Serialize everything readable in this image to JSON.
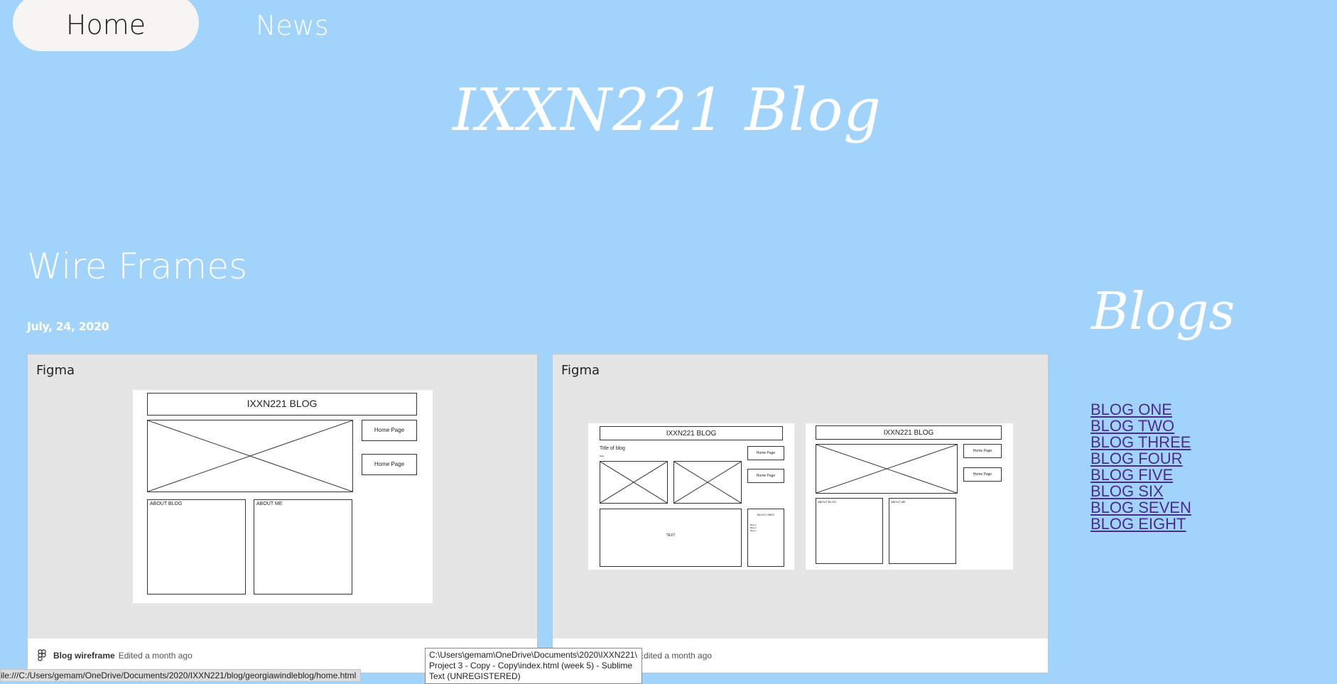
{
  "nav": {
    "home_label": "Home",
    "news_label": "News"
  },
  "site_title": "IXXN221 Blog",
  "post": {
    "title": "Wire Frames",
    "date": "July, 24, 2020"
  },
  "embeds": [
    {
      "label": "Figma",
      "footer_name": "Blog wireframe",
      "footer_meta": "Edited a month ago",
      "wireframe": {
        "header": "IXXN221 BLOG",
        "nav1": "Home Page",
        "nav2": "Home Page",
        "box1": "ABOUT BLOG",
        "box2": "ABOUT ME"
      }
    },
    {
      "label": "Figma",
      "footer_meta": "Edited a month ago",
      "wireframe_a": {
        "header": "IXXN221 BLOG",
        "subtitle": "Title of blog",
        "date": "Date",
        "nav1": "Home Page",
        "nav2": "Home Page",
        "text_box": "TEXT",
        "links_box": "BLOG LINKS",
        "links_list": "Blog 1\nBlog 2\nBlog 3"
      },
      "wireframe_b": {
        "header": "IXXN221 BLOG",
        "nav1": "Home Page",
        "nav2": "Home Page",
        "box1": "ABOUT BLOG",
        "box2": "ABOUT ME"
      }
    }
  ],
  "sidebar": {
    "title": "Blogs",
    "links": [
      "BLOG ONE",
      "BLOG TWO",
      "BLOG THREE",
      "BLOG FOUR",
      "BLOG FIVE",
      "BLOG SIX",
      "BLOG SEVEN",
      "BLOG EIGHT"
    ]
  },
  "status_bar": {
    "url": "ile:///C:/Users/gemam/OneDrive/Documents/2020/IXXN221/blog/georgiawindleblog/home.html"
  },
  "tooltip": {
    "text": "C:\\Users\\gemam\\OneDrive\\Documents\\2020\\IXXN221\\ Project 3 - Copy - Copy\\index.html (week 5) - Sublime Text (UNREGISTERED)"
  },
  "colors": {
    "background": "#a2d3fa",
    "nav_pill": "#f6f5f3",
    "link": "#4b2b8f",
    "embed_bg": "#e5e5e5"
  }
}
